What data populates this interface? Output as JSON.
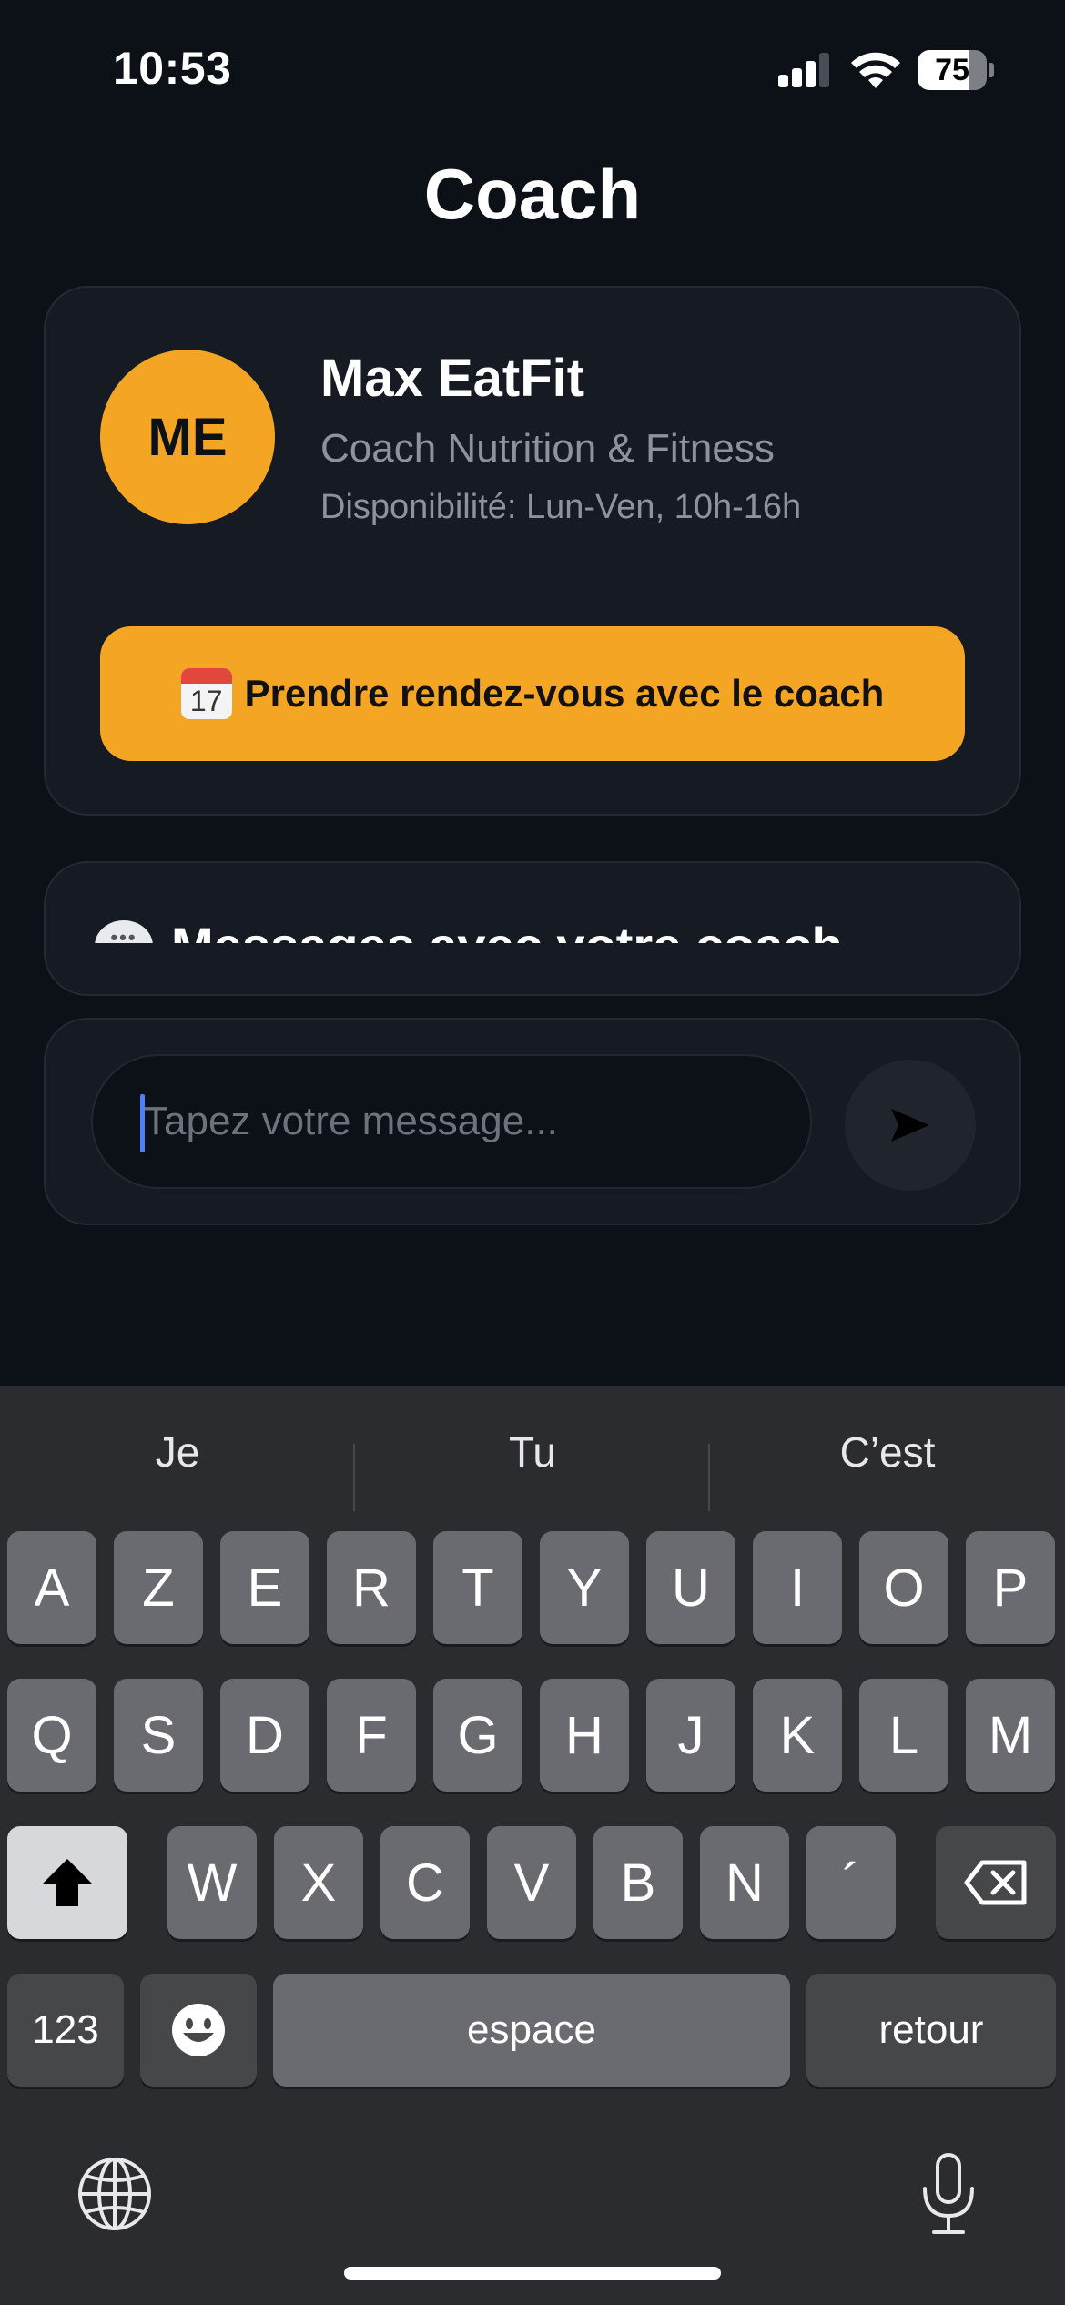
{
  "status_bar": {
    "time": "10:53",
    "battery": "75",
    "battery_level": 0.75
  },
  "header": {
    "title": "Coach"
  },
  "coach": {
    "initials": "ME",
    "name": "Max EatFit",
    "role": "Coach Nutrition & Fitness",
    "availability": "Disponibilité: Lun-Ven, 10h-16h",
    "appointment_label": "Prendre rendez-vous avec le coach",
    "calendar_day": "17"
  },
  "messages": {
    "title": "Messages avec votre coach"
  },
  "composer": {
    "placeholder": "Tapez votre message...",
    "send_icon": "➤"
  },
  "keyboard": {
    "suggestions": [
      "Je",
      "Tu",
      "C’est"
    ],
    "row1": [
      "A",
      "Z",
      "E",
      "R",
      "T",
      "Y",
      "U",
      "I",
      "O",
      "P"
    ],
    "row2": [
      "Q",
      "S",
      "D",
      "F",
      "G",
      "H",
      "J",
      "K",
      "L",
      "M"
    ],
    "row3": [
      "W",
      "X",
      "C",
      "V",
      "B",
      "N",
      "´"
    ],
    "numbers_label": "123",
    "space_label": "espace",
    "return_label": "retour"
  }
}
